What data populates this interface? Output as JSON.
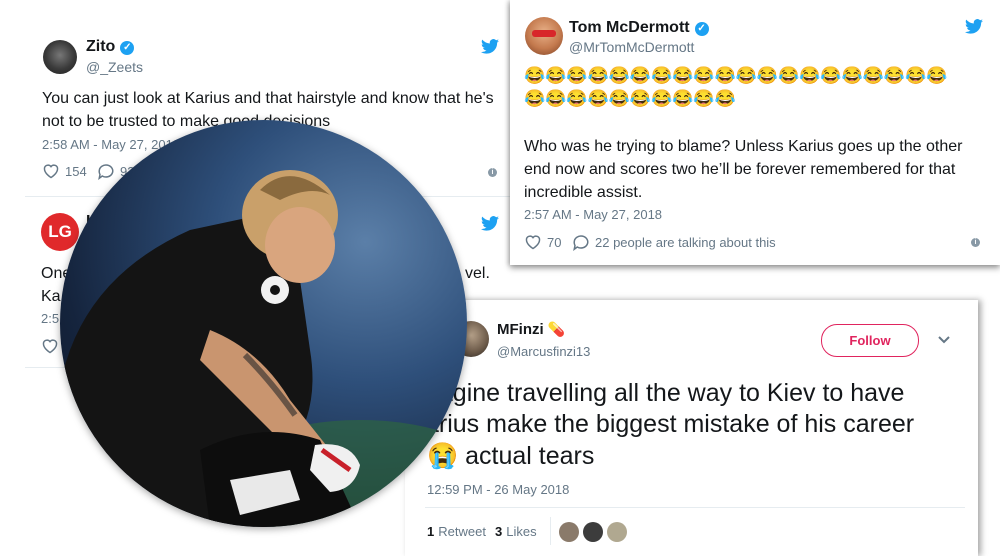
{
  "tweet_zito": {
    "name": "Zito",
    "handle": "@_Zeets",
    "text": "You can just look at Karius and that hairstyle and know that he's not to be trusted to make good decisions",
    "time": "2:58 AM - May 27, 2018",
    "likes": "154",
    "replies": "92"
  },
  "tweet_lg": {
    "name_partial": "L",
    "text_line1": "One",
    "text_line1_end": "vel.",
    "text_line2": "Ka",
    "time_partial": "2:5"
  },
  "tweet_tom": {
    "name": "Tom McDermott",
    "handle": "@MrTomMcDermott",
    "emoji_line1": "😂😂😂😂😂😂😂😂😂😂😂😂😂😂😂😂😂😂😂😂",
    "emoji_line2": "😂😂😂😂😂😂😂😂😂😂",
    "text": "Who was he trying to blame? Unless Karius goes up the other end now and scores two he’ll be forever remembered for that incredible assist.",
    "time": "2:57 AM - May 27, 2018",
    "likes": "70",
    "talking": "22 people are talking about this"
  },
  "tweet_mfinzi": {
    "name": "MFinzi",
    "name_emoji": "💊",
    "handle": "@Marcusfinzi13",
    "follow_label": "Follow",
    "text_line1": "nagine travelling all the way to Kiev to have",
    "text_line2": "arius make the biggest mistake of his career",
    "text_line3_emoji": "😭",
    "text_line3": "actual tears",
    "time": "12:59 PM - 26 May 2018",
    "retweets": "1",
    "retweet_label": "Retweet",
    "likes": "3",
    "likes_label": "Likes"
  },
  "colors": {
    "twitter_blue": "#1da1f2",
    "follow_red": "#e0245e",
    "meta_gray": "#657786"
  }
}
